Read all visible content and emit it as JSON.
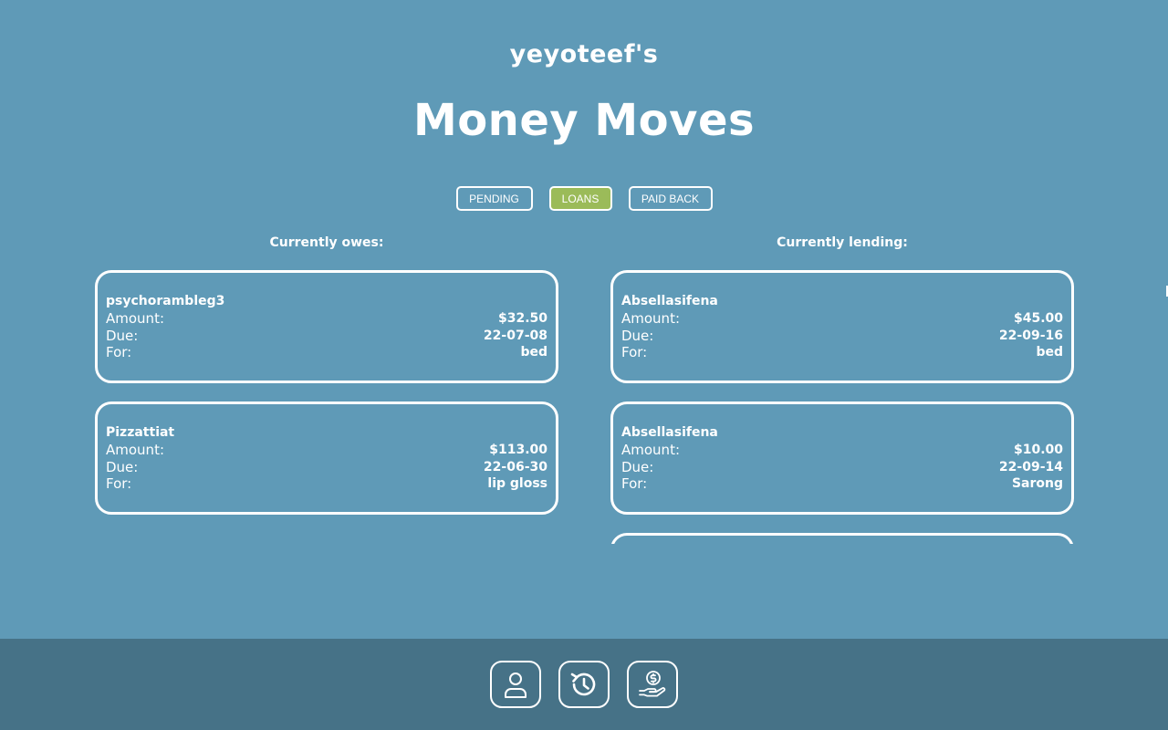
{
  "header": {
    "owner_title": "yeyoteef's",
    "app_title": "Money Moves"
  },
  "tabs": [
    {
      "label": "PENDING",
      "active": false
    },
    {
      "label": "LOANS",
      "active": true
    },
    {
      "label": "PAID BACK",
      "active": false
    }
  ],
  "labels": {
    "amount": "Amount:",
    "due": "Due:",
    "for": "For:"
  },
  "owes": {
    "heading": "Currently owes:",
    "items": [
      {
        "name": "psychorambleg3",
        "amount": "$32.50",
        "due": "22-07-08",
        "for": "bed"
      },
      {
        "name": "Pizzattiat",
        "amount": "$113.00",
        "due": "22-06-30",
        "for": "lip gloss"
      }
    ]
  },
  "lending": {
    "heading": "Currently lending:",
    "items": [
      {
        "name": "Absellasifena",
        "amount": "$45.00",
        "due": "22-09-16",
        "for": "bed"
      },
      {
        "name": "Absellasifena",
        "amount": "$10.00",
        "due": "22-09-14",
        "for": "Sarong"
      }
    ]
  },
  "footer_nav": [
    {
      "icon": "user-icon"
    },
    {
      "icon": "history-icon"
    },
    {
      "icon": "money-hand-icon"
    }
  ],
  "colors": {
    "background": "#5f9ab7",
    "footer": "#467287",
    "active_tab": "#9bbb59",
    "text": "#ffffff"
  }
}
